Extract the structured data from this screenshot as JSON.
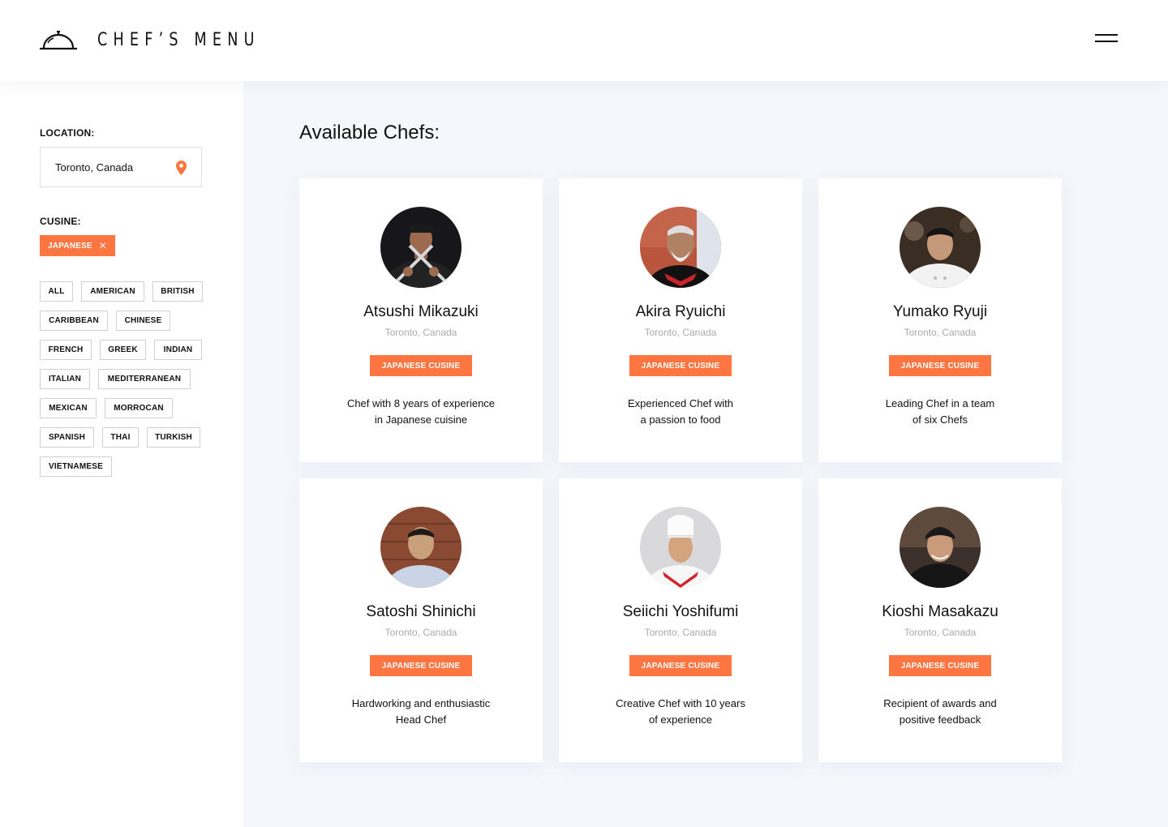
{
  "header": {
    "logo_text": "CHEF’S MENU"
  },
  "sidebar": {
    "location_label": "LOCATION:",
    "location_value": "Toronto, Canada",
    "cusine_label": "CUSINE:",
    "selected_cuisine": "JAPANESE",
    "cuisines": [
      "ALL",
      "AMERICAN",
      "BRITISH",
      "CARIBBEAN",
      "CHINESE",
      "FRENCH",
      "GREEK",
      "INDIAN",
      "ITALIAN",
      "MEDITERRANEAN",
      "MEXICAN",
      "MORROCAN",
      "SPANISH",
      "THAI",
      "TURKISH",
      "VIETNAMESE"
    ]
  },
  "main": {
    "title": "Available Chefs:",
    "chefs": [
      {
        "name": "Atsushi Mikazuki",
        "location": "Toronto, Canada",
        "cuisine": "JAPANESE CUSINE",
        "desc1": "Chef with 8 years of experience",
        "desc2": "in Japanese cuisine"
      },
      {
        "name": "Akira Ryuichi",
        "location": "Toronto, Canada",
        "cuisine": "JAPANESE CUSINE",
        "desc1": "Experienced Chef with",
        "desc2": "a passion to food"
      },
      {
        "name": "Yumako Ryuji",
        "location": "Toronto, Canada",
        "cuisine": "JAPANESE CUSINE",
        "desc1": "Leading Chef in a team",
        "desc2": "of six Chefs"
      },
      {
        "name": "Satoshi Shinichi",
        "location": "Toronto, Canada",
        "cuisine": "JAPANESE CUSINE",
        "desc1": "Hardworking and enthusiastic",
        "desc2": "Head Chef"
      },
      {
        "name": "Seiichi Yoshifumi",
        "location": "Toronto, Canada",
        "cuisine": "JAPANESE CUSINE",
        "desc1": "Creative Chef with 10 years",
        "desc2": "of experience"
      },
      {
        "name": "Kioshi Masakazu",
        "location": "Toronto, Canada",
        "cuisine": "JAPANESE CUSINE",
        "desc1": "Recipient of awards and",
        "desc2": "positive feedback"
      }
    ]
  },
  "colors": {
    "accent": "#fd7540",
    "main_bg": "#f6f7fc",
    "text": "#111111",
    "muted": "#aaaaaa",
    "border": "#cfd1d8"
  },
  "icons": {
    "logo": "cloche-icon",
    "menu": "hamburger-menu-icon",
    "location": "map-pin-icon",
    "remove": "close-icon"
  }
}
